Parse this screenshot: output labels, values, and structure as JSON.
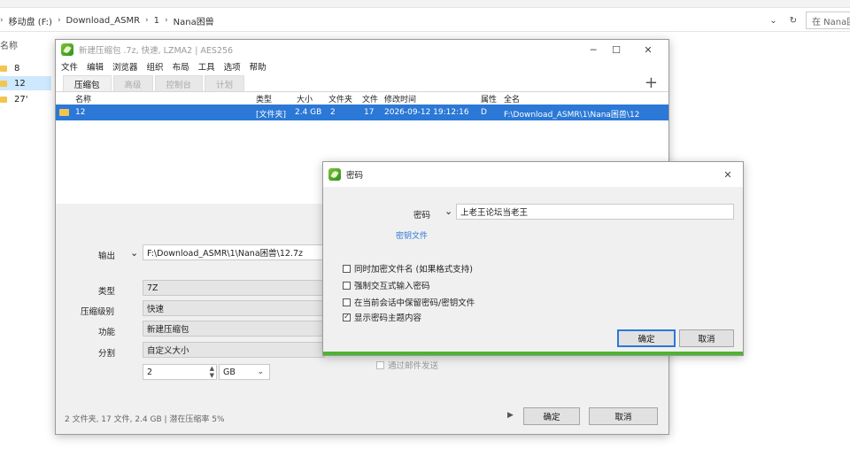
{
  "explorer": {
    "path": [
      "移动盘 (F:)",
      "Download_ASMR",
      "1",
      "Nana困兽"
    ],
    "search_placeholder": "在 Nana困",
    "left_header": "名称",
    "folders": [
      "8",
      "12",
      "27'"
    ]
  },
  "main_window": {
    "title": "新建压缩包 .7z, 快速, LZMA2 | AES256",
    "menu": [
      "文件",
      "编辑",
      "浏览器",
      "组织",
      "布局",
      "工具",
      "选项",
      "帮助"
    ],
    "tabs": [
      "压缩包",
      "高级",
      "控制台",
      "计划"
    ],
    "columns": [
      "名称",
      "类型",
      "大小",
      "文件夹",
      "文件",
      "修改时间",
      "属性",
      "全名"
    ],
    "row": {
      "name": "12",
      "type": "[文件夹]",
      "size": "2.4 GB",
      "folders": "2",
      "files": "17",
      "modified": "2026-09-12 19:12:16",
      "attr": "D",
      "fullname": "F:\\Download_ASMR\\1\\Nana困兽\\12"
    },
    "output_label": "输出",
    "output_value": "F:\\Download_ASMR\\1\\Nana困兽\\12.7z",
    "type_label": "类型",
    "type_value": "7Z",
    "level_label": "压缩级别",
    "level_value": "快速",
    "function_label": "功能",
    "function_value": "新建压缩包",
    "split_label": "分割",
    "split_value": "自定义大小",
    "split_size": "2",
    "split_unit": "GB",
    "send_mail": "通过邮件发送",
    "status": "2 文件夹, 17 文件, 2.4 GB | 潜在压缩率 5%",
    "ok": "确定",
    "cancel": "取消"
  },
  "password_dialog": {
    "title": "密码",
    "password_label": "密码",
    "password_value": "上老王论坛当老王",
    "keyfile_link": "密钥文件",
    "options": [
      {
        "label": "同时加密文件名 (如果格式支持)",
        "checked": false
      },
      {
        "label": "强制交互式输入密码",
        "checked": false
      },
      {
        "label": "在当前会话中保留密码/密钥文件",
        "checked": false
      },
      {
        "label": "显示密码主题内容",
        "checked": true
      }
    ],
    "ok": "确定",
    "cancel": "取消"
  }
}
